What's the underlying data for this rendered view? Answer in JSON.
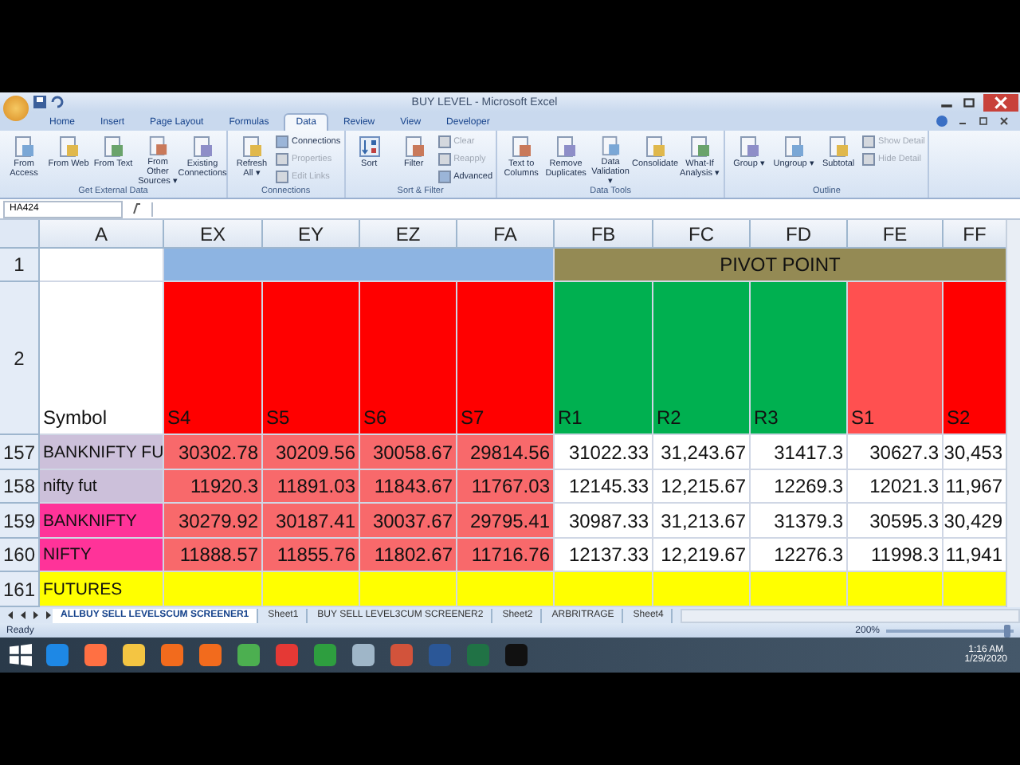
{
  "window": {
    "title": "BUY LEVEL - Microsoft Excel"
  },
  "ribbon": {
    "tabs": [
      {
        "label": "Home",
        "selected": false
      },
      {
        "label": "Insert",
        "selected": false
      },
      {
        "label": "Page Layout",
        "selected": false
      },
      {
        "label": "Formulas",
        "selected": false
      },
      {
        "label": "Data",
        "selected": true
      },
      {
        "label": "Review",
        "selected": false
      },
      {
        "label": "View",
        "selected": false
      },
      {
        "label": "Developer",
        "selected": false
      }
    ],
    "groups": [
      {
        "name": "Get External Data",
        "buttons": [
          {
            "kind": "large",
            "label": "From Access",
            "disabled": false
          },
          {
            "kind": "large",
            "label": "From Web",
            "disabled": false
          },
          {
            "kind": "large",
            "label": "From Text",
            "disabled": false
          },
          {
            "kind": "large",
            "label": "From Other Sources ▾",
            "disabled": false
          },
          {
            "kind": "large",
            "label": "Existing Connections",
            "disabled": false
          }
        ]
      },
      {
        "name": "Connections",
        "buttons": [
          {
            "kind": "large",
            "label": "Refresh All ▾",
            "disabled": false
          },
          {
            "kind": "small",
            "label": "Connections",
            "disabled": false
          },
          {
            "kind": "small",
            "label": "Properties",
            "disabled": true
          },
          {
            "kind": "small",
            "label": "Edit Links",
            "disabled": true
          }
        ]
      },
      {
        "name": "Sort & Filter",
        "buttons": [
          {
            "kind": "sort",
            "label": "Sort",
            "disabled": false
          },
          {
            "kind": "large",
            "label": "Filter",
            "disabled": false
          },
          {
            "kind": "small",
            "label": "Clear",
            "disabled": true
          },
          {
            "kind": "small",
            "label": "Reapply",
            "disabled": true
          },
          {
            "kind": "small",
            "label": "Advanced",
            "disabled": false
          }
        ]
      },
      {
        "name": "Data Tools",
        "buttons": [
          {
            "kind": "large",
            "label": "Text to Columns",
            "disabled": false
          },
          {
            "kind": "large",
            "label": "Remove Duplicates",
            "disabled": false
          },
          {
            "kind": "large",
            "label": "Data Validation ▾",
            "disabled": false
          },
          {
            "kind": "large",
            "label": "Consolidate",
            "disabled": false
          },
          {
            "kind": "large",
            "label": "What-If Analysis ▾",
            "disabled": false
          }
        ]
      },
      {
        "name": "Outline",
        "buttons": [
          {
            "kind": "large",
            "label": "Group ▾",
            "disabled": false
          },
          {
            "kind": "large",
            "label": "Ungroup ▾",
            "disabled": false
          },
          {
            "kind": "large",
            "label": "Subtotal",
            "disabled": false
          },
          {
            "kind": "small",
            "label": "Show Detail",
            "disabled": true
          },
          {
            "kind": "small",
            "label": "Hide Detail",
            "disabled": true
          }
        ]
      }
    ]
  },
  "formula_bar": {
    "name_box": "HA424"
  },
  "sheet": {
    "columns": [
      {
        "name": "A",
        "label": "Symbol",
        "color": "#ffffff"
      },
      {
        "name": "EX",
        "label": "S4",
        "color": "#ff0000"
      },
      {
        "name": "EY",
        "label": "S5",
        "color": "#ff0000"
      },
      {
        "name": "EZ",
        "label": "S6",
        "color": "#ff0000"
      },
      {
        "name": "FA",
        "label": "S7",
        "color": "#ff0000"
      },
      {
        "name": "FB",
        "label": "R1",
        "color": "#00b050"
      },
      {
        "name": "FC",
        "label": "R2",
        "color": "#00b050"
      },
      {
        "name": "FD",
        "label": "R3",
        "color": "#00b050"
      },
      {
        "name": "FE",
        "label": "S1",
        "color": "#ff5050"
      },
      {
        "name": "FF",
        "label": "S2",
        "color": "#ff0000"
      }
    ],
    "banner": {
      "label": "PIVOT POINT"
    },
    "rows": [
      {
        "number": "157",
        "cells": [
          {
            "text": "BANKNIFTY FU",
            "color": "#ccc0da"
          },
          {
            "text": "30302.78",
            "color": "#f8696b"
          },
          {
            "text": "30209.56",
            "color": "#f8696b"
          },
          {
            "text": "30058.67",
            "color": "#f8696b"
          },
          {
            "text": "29814.56",
            "color": "#f8696b"
          },
          {
            "text": "31022.33",
            "color": "#ffffff"
          },
          {
            "text": "31,243.67",
            "color": "#ffffff"
          },
          {
            "text": "31417.3",
            "color": "#ffffff"
          },
          {
            "text": "30627.3",
            "color": "#ffffff"
          },
          {
            "text": "30,453",
            "color": "#ffffff"
          }
        ]
      },
      {
        "number": "158",
        "cells": [
          {
            "text": "nifty fut",
            "color": "#ccc0da"
          },
          {
            "text": "11920.3",
            "color": "#f8696b"
          },
          {
            "text": "11891.03",
            "color": "#f8696b"
          },
          {
            "text": "11843.67",
            "color": "#f8696b"
          },
          {
            "text": "11767.03",
            "color": "#f8696b"
          },
          {
            "text": "12145.33",
            "color": "#ffffff"
          },
          {
            "text": "12,215.67",
            "color": "#ffffff"
          },
          {
            "text": "12269.3",
            "color": "#ffffff"
          },
          {
            "text": "12021.3",
            "color": "#ffffff"
          },
          {
            "text": "11,967",
            "color": "#ffffff"
          }
        ]
      },
      {
        "number": "159",
        "cells": [
          {
            "text": "BANKNIFTY",
            "color": "#ff3399"
          },
          {
            "text": "30279.92",
            "color": "#f8696b"
          },
          {
            "text": "30187.41",
            "color": "#f8696b"
          },
          {
            "text": "30037.67",
            "color": "#f8696b"
          },
          {
            "text": "29795.41",
            "color": "#f8696b"
          },
          {
            "text": "30987.33",
            "color": "#ffffff"
          },
          {
            "text": "31,213.67",
            "color": "#ffffff"
          },
          {
            "text": "31379.3",
            "color": "#ffffff"
          },
          {
            "text": "30595.3",
            "color": "#ffffff"
          },
          {
            "text": "30,429",
            "color": "#ffffff"
          }
        ]
      },
      {
        "number": "160",
        "cells": [
          {
            "text": "NIFTY",
            "color": "#ff3399"
          },
          {
            "text": "11888.57",
            "color": "#f8696b"
          },
          {
            "text": "11855.76",
            "color": "#f8696b"
          },
          {
            "text": "11802.67",
            "color": "#f8696b"
          },
          {
            "text": "11716.76",
            "color": "#f8696b"
          },
          {
            "text": "12137.33",
            "color": "#ffffff"
          },
          {
            "text": "12,219.67",
            "color": "#ffffff"
          },
          {
            "text": "12276.3",
            "color": "#ffffff"
          },
          {
            "text": "11998.3",
            "color": "#ffffff"
          },
          {
            "text": "11,941",
            "color": "#ffffff"
          }
        ]
      },
      {
        "number": "161",
        "cells": [
          {
            "text": "FUTURES",
            "color": "#ffff00"
          },
          {
            "color": "#ffff00"
          },
          {
            "color": "#ffff00"
          },
          {
            "color": "#ffff00"
          },
          {
            "color": "#ffff00"
          },
          {
            "color": "#ffff00"
          },
          {
            "color": "#ffff00"
          },
          {
            "color": "#ffff00"
          },
          {
            "color": "#ffff00"
          },
          {
            "color": "#ffff00"
          }
        ]
      }
    ],
    "first_rows": [
      "1",
      "2"
    ]
  },
  "sheet_tabs": [
    {
      "label": "ALLBUY SELL LEVELSCUM SCREENER1",
      "selected": true
    },
    {
      "label": "Sheet1",
      "selected": false
    },
    {
      "label": "BUY SELL LEVEL3CUM SCREENER2",
      "selected": false
    },
    {
      "label": "Sheet2",
      "selected": false
    },
    {
      "label": "ARBRITRAGE",
      "selected": false
    },
    {
      "label": "Sheet4",
      "selected": false
    }
  ],
  "status_bar": {
    "status": "Ready",
    "zoom": "200%",
    "zoom_slider": {
      "level": 0.95
    }
  },
  "taskbar": {
    "time": "1:16 AM",
    "date": "1/29/2020"
  }
}
